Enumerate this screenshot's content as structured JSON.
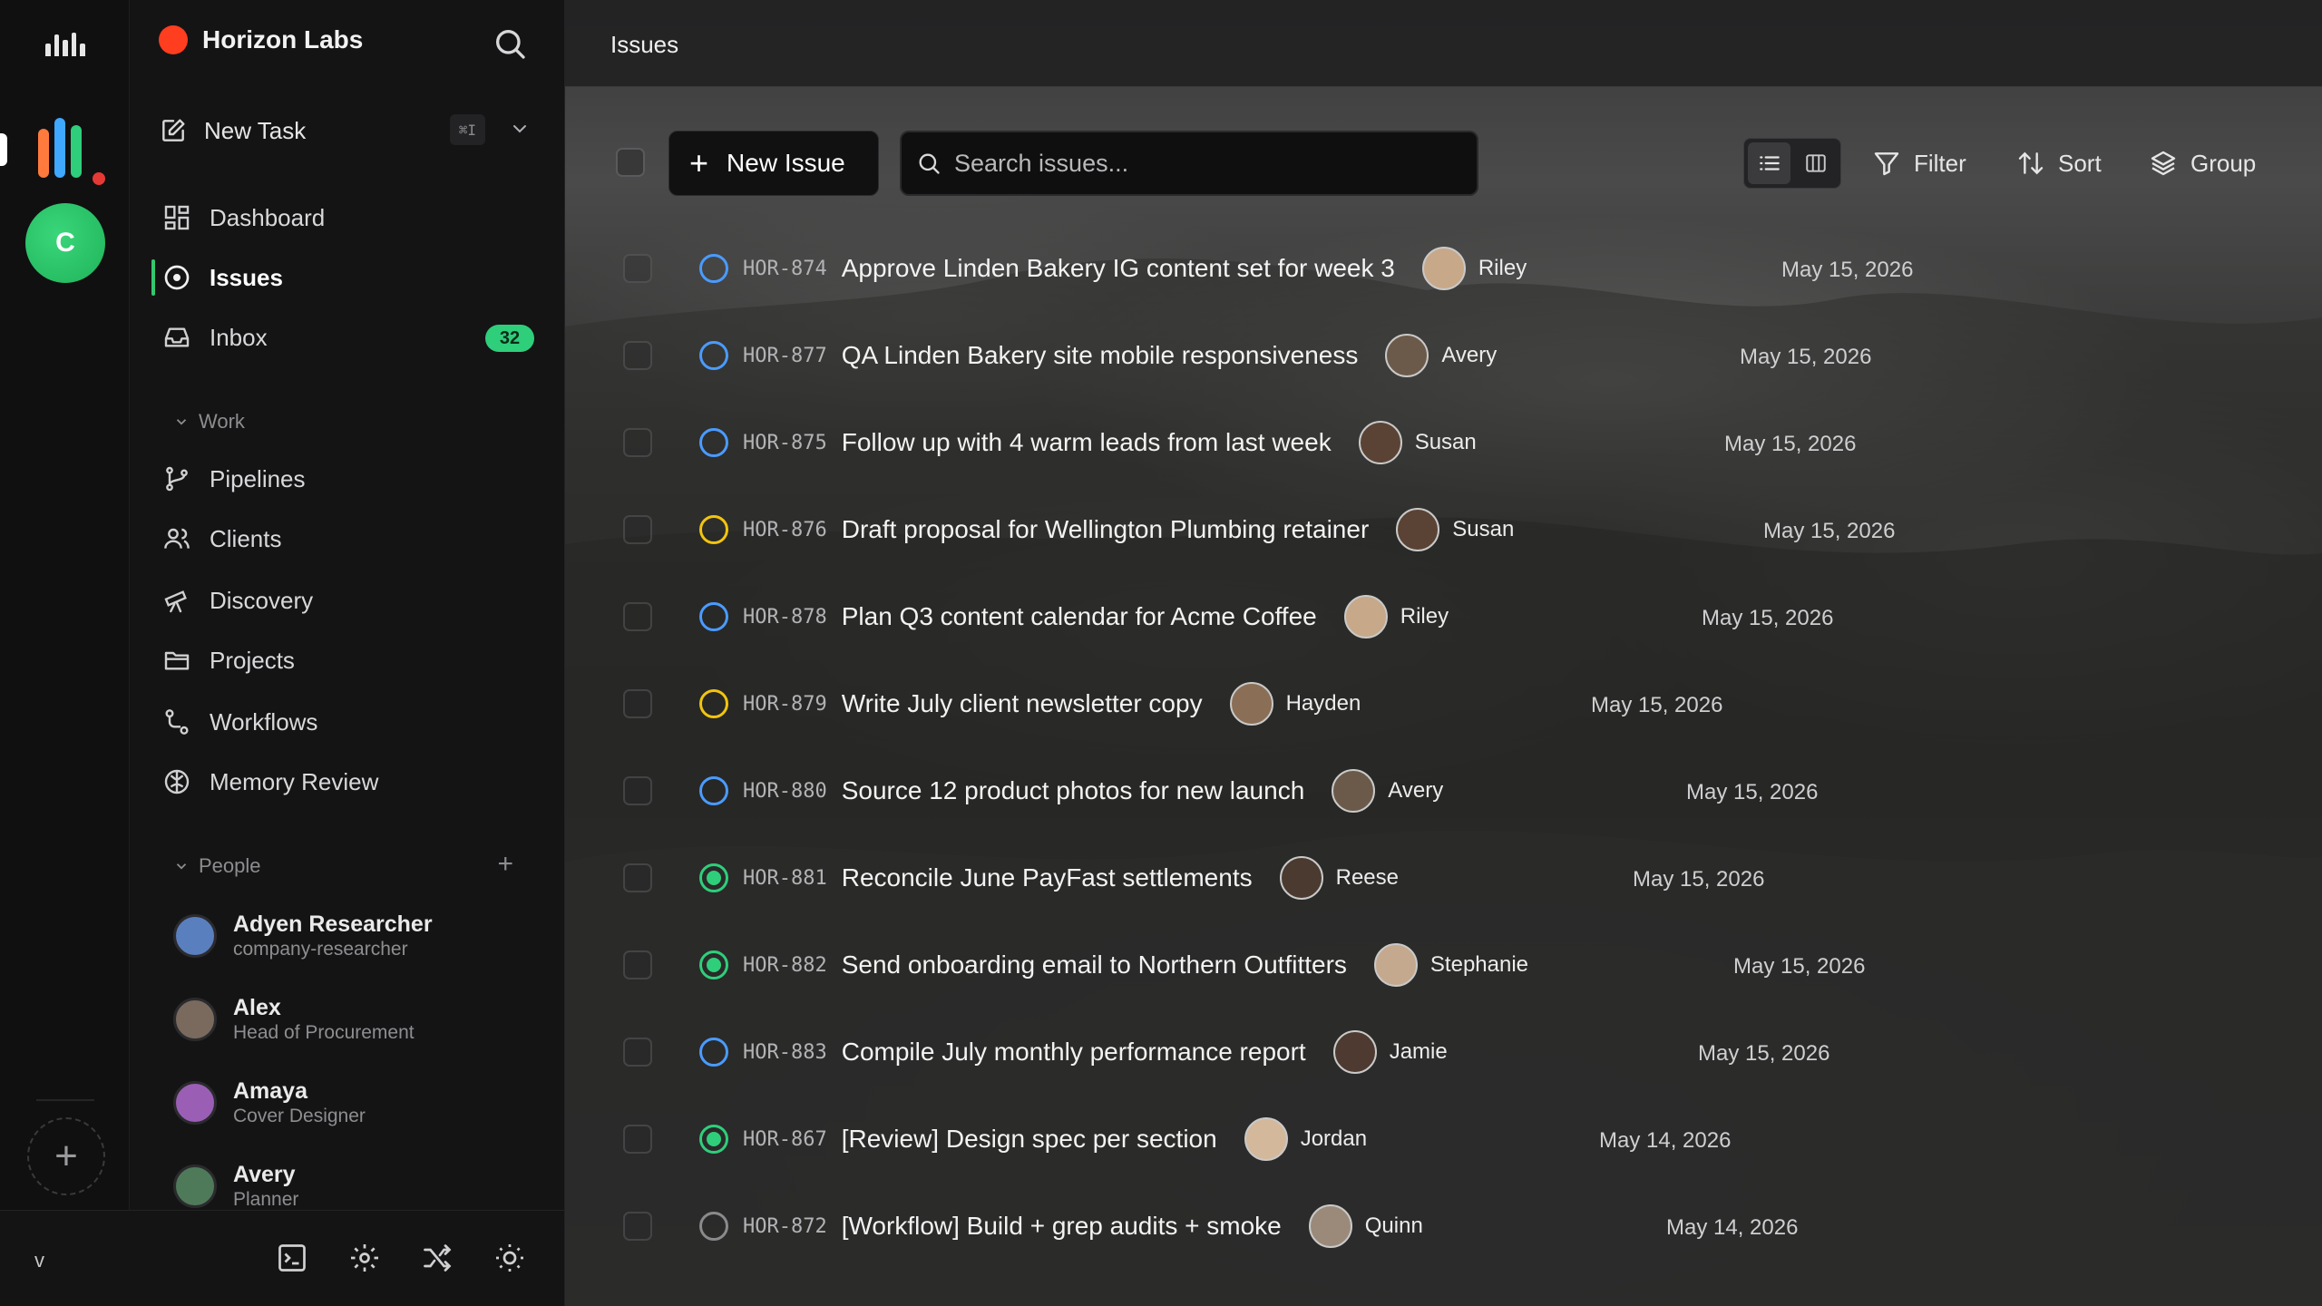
{
  "rail": {
    "workspace_initial": "C"
  },
  "sidebar": {
    "org_name": "Horizon Labs",
    "new_task": {
      "label": "New Task",
      "shortcut": "⌘I"
    },
    "nav": [
      {
        "label": "Dashboard",
        "icon": "dashboard-icon"
      },
      {
        "label": "Issues",
        "icon": "issues-icon",
        "active": true
      },
      {
        "label": "Inbox",
        "icon": "inbox-icon",
        "badge": "32"
      }
    ],
    "work_section": {
      "title": "Work"
    },
    "work_items": [
      {
        "label": "Pipelines",
        "icon": "pipelines-icon"
      },
      {
        "label": "Clients",
        "icon": "clients-icon"
      },
      {
        "label": "Discovery",
        "icon": "telescope-icon"
      },
      {
        "label": "Projects",
        "icon": "folder-icon"
      },
      {
        "label": "Workflows",
        "icon": "workflow-icon"
      },
      {
        "label": "Memory Review",
        "icon": "brain-icon"
      }
    ],
    "people_section": {
      "title": "People",
      "add": "+"
    },
    "people": [
      {
        "name": "Adyen Researcher",
        "role": "company-researcher",
        "color": "#5a7fbf"
      },
      {
        "name": "Alex",
        "role": "Head of Procurement",
        "color": "#7a6a5e"
      },
      {
        "name": "Amaya",
        "role": "Cover Designer",
        "color": "#9a5fb5"
      },
      {
        "name": "Avery",
        "role": "Planner",
        "color": "#4f7a5a"
      }
    ],
    "footer": {
      "version": "v"
    }
  },
  "main": {
    "title": "Issues",
    "toolbar": {
      "new_issue": "New Issue",
      "search_placeholder": "Search issues...",
      "filter": "Filter",
      "sort": "Sort",
      "group": "Group"
    },
    "issues": [
      {
        "key": "HOR-874",
        "title": "Approve Linden Bakery IG content set for week 3",
        "assignee": "Riley",
        "date": "May 15, 2026",
        "status": "blue"
      },
      {
        "key": "HOR-877",
        "title": "QA Linden Bakery site mobile responsiveness",
        "assignee": "Avery",
        "date": "May 15, 2026",
        "status": "blue"
      },
      {
        "key": "HOR-875",
        "title": "Follow up with 4 warm leads from last week",
        "assignee": "Susan",
        "date": "May 15, 2026",
        "status": "blue"
      },
      {
        "key": "HOR-876",
        "title": "Draft proposal for Wellington Plumbing retainer",
        "assignee": "Susan",
        "date": "May 15, 2026",
        "status": "yellow"
      },
      {
        "key": "HOR-878",
        "title": "Plan Q3 content calendar for Acme Coffee",
        "assignee": "Riley",
        "date": "May 15, 2026",
        "status": "blue"
      },
      {
        "key": "HOR-879",
        "title": "Write July client newsletter copy",
        "assignee": "Hayden",
        "date": "May 15, 2026",
        "status": "yellow"
      },
      {
        "key": "HOR-880",
        "title": "Source 12 product photos for new launch",
        "assignee": "Avery",
        "date": "May 15, 2026",
        "status": "blue"
      },
      {
        "key": "HOR-881",
        "title": "Reconcile June PayFast settlements",
        "assignee": "Reese",
        "date": "May 15, 2026",
        "status": "done"
      },
      {
        "key": "HOR-882",
        "title": "Send onboarding email to Northern Outfitters",
        "assignee": "Stephanie",
        "date": "May 15, 2026",
        "status": "done"
      },
      {
        "key": "HOR-883",
        "title": "Compile July monthly performance report",
        "assignee": "Jamie",
        "date": "May 15, 2026",
        "status": "blue"
      },
      {
        "key": "HOR-867",
        "title": "[Review] Design spec per section",
        "assignee": "Jordan",
        "date": "May 14, 2026",
        "status": "done"
      },
      {
        "key": "HOR-872",
        "title": "[Workflow] Build + grep audits + smoke",
        "assignee": "Quinn",
        "date": "May 14, 2026",
        "status": "grey"
      }
    ]
  }
}
